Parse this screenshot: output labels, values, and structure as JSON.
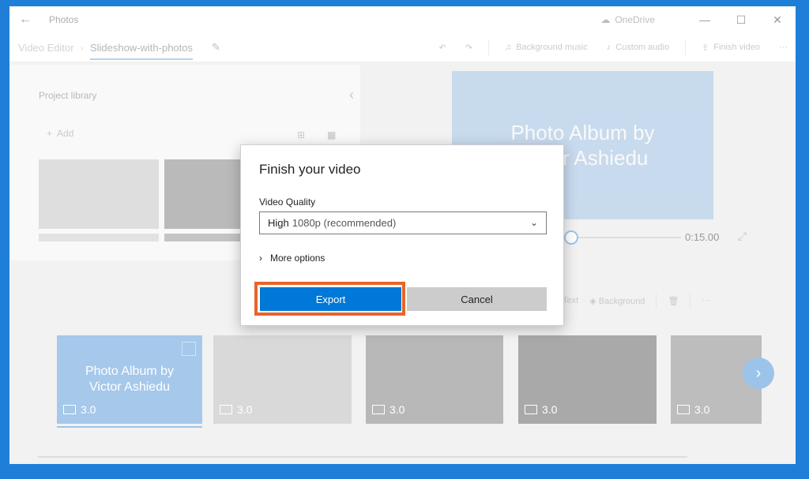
{
  "titlebar": {
    "back_icon": "arrow-left-icon",
    "title": "Photos",
    "onedrive_label": "OneDrive",
    "controls": [
      "minimize",
      "maximize",
      "close"
    ]
  },
  "commandbar": {
    "breadcrumb_root": "Video Editor",
    "breadcrumb_current": "Slideshow-with-photos",
    "background_music": "Background music",
    "custom_audio": "Custom audio",
    "finish_video": "Finish video"
  },
  "library": {
    "title": "Project library",
    "add_label": "Add"
  },
  "preview": {
    "title_line1": "Photo Album by",
    "title_line2": "Victor Ashiedu",
    "timecode": "0:15.00"
  },
  "storyboard_toolbar": {
    "text_label": "Text",
    "background_label": "Background"
  },
  "storyboard": {
    "cards": [
      {
        "title_line1": "Photo Album by",
        "title_line2": "Victor Ashiedu",
        "duration": "3.0"
      },
      {
        "duration": "3.0"
      },
      {
        "duration": "3.0"
      },
      {
        "duration": "3.0"
      },
      {
        "duration": "3.0"
      }
    ]
  },
  "dialog": {
    "title": "Finish your video",
    "quality_label": "Video Quality",
    "quality_value_main": "High",
    "quality_value_sub": "1080p (recommended)",
    "more_options": "More options",
    "export_label": "Export",
    "cancel_label": "Cancel"
  },
  "colors": {
    "accent": "#0078d7",
    "highlight_outline": "#e8642a",
    "preview_bg": "#a6c8ea"
  }
}
